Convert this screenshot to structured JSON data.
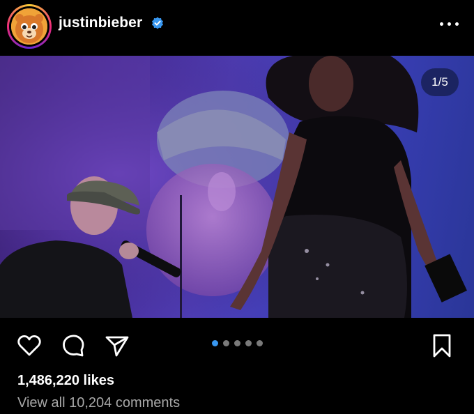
{
  "post": {
    "username": "justinbieber",
    "verified": true,
    "image_counter": "1/5",
    "likes": "1,486,220 likes",
    "comments_link": "View all 10,204 comments"
  },
  "carousel": {
    "total": 5,
    "active": 1
  },
  "colors": {
    "verified": "#3897f0",
    "active_dot": "#3897f0",
    "inactive_dot": "#7a7a7a",
    "muted_text": "#a8a8a8"
  },
  "icons": {
    "header": [
      "verified-badge-icon",
      "more-options-icon"
    ],
    "actions": [
      "heart-icon",
      "comment-icon",
      "share-icon",
      "bookmark-icon"
    ]
  }
}
